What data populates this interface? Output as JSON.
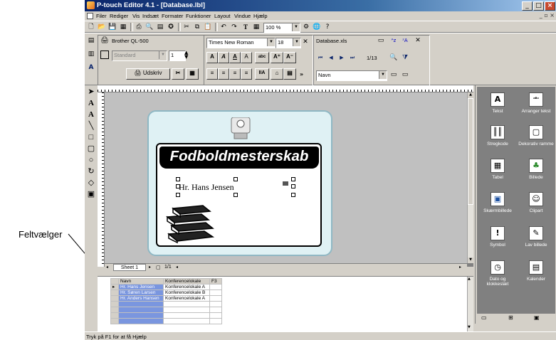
{
  "window": {
    "title": "P-touch Editor 4.1 - [Database.lbl]"
  },
  "menu": [
    "Filer",
    "Rediger",
    "Vis",
    "Indsæt",
    "Formater",
    "Funktioner",
    "Layout",
    "Vindue",
    "Hjælp"
  ],
  "toolbar": {
    "zoom": "100 %",
    "printer": "Brother QL-500",
    "format": "Standard",
    "copies": "1",
    "print_label": "Udskriv",
    "font": "Times New Roman",
    "font_size": "18",
    "db_file": "Database.xls",
    "record": "1/13",
    "field": "Navn"
  },
  "label": {
    "title": "Fodboldmesterskab",
    "name": "Hr. Hans Jensen"
  },
  "sheet": {
    "tab": "Sheet 1",
    "pages": "1/1"
  },
  "gallery": [
    {
      "label": "Tekst",
      "icon": "text-icon"
    },
    {
      "label": "Arranger tekst",
      "icon": "arrange-text-icon"
    },
    {
      "label": "Stregkode",
      "icon": "barcode-icon"
    },
    {
      "label": "Dekorativ ramme",
      "icon": "frame-icon"
    },
    {
      "label": "Tabel",
      "icon": "table-icon"
    },
    {
      "label": "Billede",
      "icon": "picture-icon"
    },
    {
      "label": "Skærmbillede",
      "icon": "screenshot-icon"
    },
    {
      "label": "Clipart",
      "icon": "clipart-icon"
    },
    {
      "label": "Symbol",
      "icon": "symbol-icon"
    },
    {
      "label": "Lav billede",
      "icon": "make-image-icon"
    },
    {
      "label": "Dato og klokkeslæt",
      "icon": "clock-icon"
    },
    {
      "label": "Kalender",
      "icon": "calendar-icon"
    }
  ],
  "database": {
    "columns": [
      "Navn",
      "Konferencelokale",
      "F3"
    ],
    "rows": [
      [
        "Hr. Hans Jensen",
        "Konferencelokale A"
      ],
      [
        "Hr. Søren Larsen",
        "Konferencelokale B"
      ],
      [
        "Hr. Anders Hansen",
        "Konferencelokale A"
      ]
    ]
  },
  "status": "Tryk på F1 for at få Hjælp",
  "callout": "Feltvælger"
}
